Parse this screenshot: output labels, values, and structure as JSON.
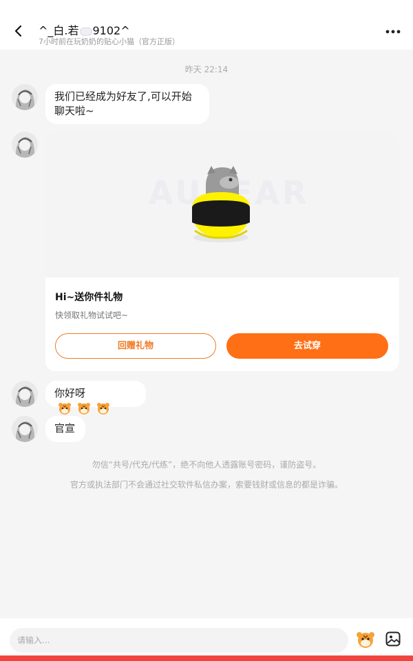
{
  "header": {
    "title": "^_白.若",
    "title_suffix": "9102^",
    "subtitle": "7小时前在玩奶奶的贴心小猫（官方正版）"
  },
  "chat": {
    "timestamp": "昨天 22:14",
    "messages": [
      {
        "text": "我们已经成为好友了,可以开始\n聊天啦~"
      },
      {
        "text": "你好呀"
      },
      {
        "text": "官宣"
      }
    ],
    "gift_card": {
      "watermark": "AUREAR",
      "title": "Hi~送你件礼物",
      "subtitle": "快领取礼物试试吧~",
      "return_gift_label": "回赠礼物",
      "try_on_label": "去试穿"
    }
  },
  "notices": {
    "line1": "勿信“共号/代充/代练”，绝不向他人透露账号密码，谨防盗号。",
    "line2": "官方或执法部门不会通过社交软件私信办案，索要钱财或信息的都是诈骗。"
  },
  "footer": {
    "input_placeholder": "请输入..."
  },
  "colors": {
    "accent": "#ff6f15",
    "bottom_bar": "#f0453f"
  }
}
